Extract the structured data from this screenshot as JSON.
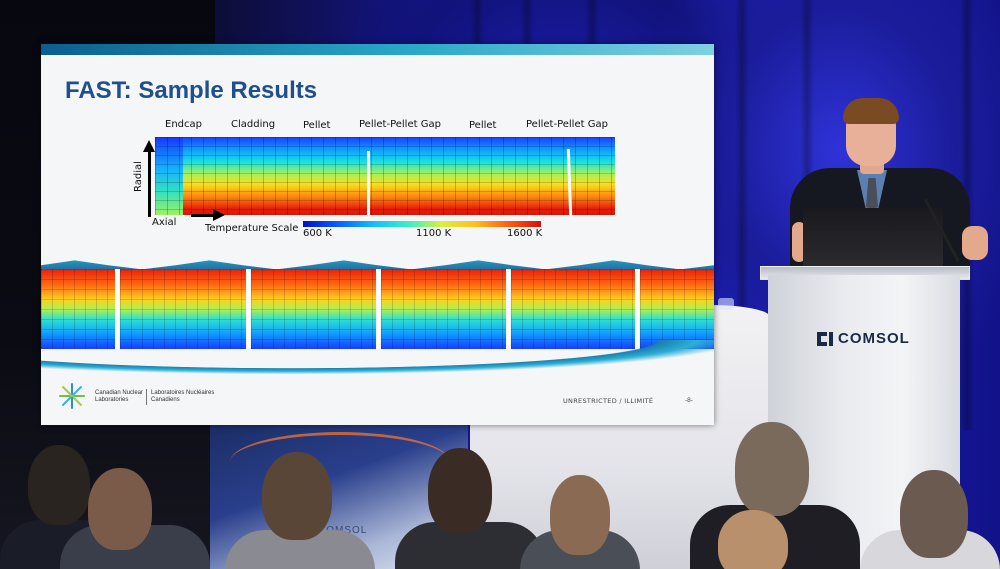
{
  "slide": {
    "title": "FAST: Sample Results",
    "labels": {
      "endcap": "Endcap",
      "cladding": "Cladding",
      "pellet_1": "Pellet",
      "gap_1": "Pellet-Pellet Gap",
      "pellet_2": "Pellet",
      "gap_2": "Pellet-Pellet Gap",
      "radial": "Radial",
      "axial": "Axial",
      "temperature_scale": "Temperature Scale",
      "scale_min": "600 K",
      "scale_mid": "1100 K",
      "scale_max": "1600 K"
    },
    "footer": {
      "org_en_line1": "Canadian Nuclear",
      "org_en_line2": "Laboratories",
      "org_fr_line1": "Laboratoires Nucléaires",
      "org_fr_line2": "Canadiens",
      "classification": "UNRESTRICTED / ILLIMITÉ",
      "page": "-8-"
    }
  },
  "podium": {
    "logo_text": "COMSOL"
  },
  "banner": {
    "text": "COMSOL"
  },
  "colors": {
    "title_blue": "#1f4f8f",
    "temperature_low": "#0010c8",
    "temperature_high": "#d81008",
    "stage_blue": "#1c1fb8"
  },
  "icons": {
    "cnl_logo": "cnl-starburst-icon",
    "comsol_mark": "comsol-mark-icon"
  }
}
